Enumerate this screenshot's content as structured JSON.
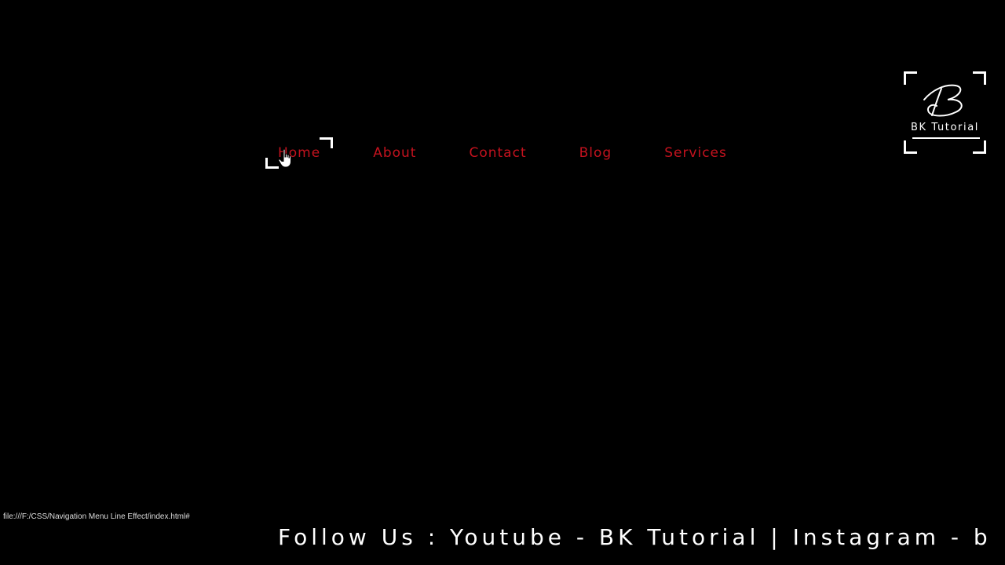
{
  "nav": {
    "items": [
      {
        "label": "Home"
      },
      {
        "label": "About"
      },
      {
        "label": "Contact"
      },
      {
        "label": "Blog"
      },
      {
        "label": "Services"
      }
    ],
    "active_index": 0
  },
  "logo": {
    "text": "BK Tutorial"
  },
  "status_bar": {
    "url": "file:///F:/CSS/Navigation Menu Line Effect/index.html#"
  },
  "ticker": {
    "text": "Follow Us : Youtube - BK Tutorial | Instagram - b"
  },
  "colors": {
    "background": "#000000",
    "nav_text": "#c4121e",
    "accent": "#ffffff"
  },
  "icons": {
    "cursor": "hand-pointer-icon",
    "logo": "bk-script-logo-icon"
  }
}
